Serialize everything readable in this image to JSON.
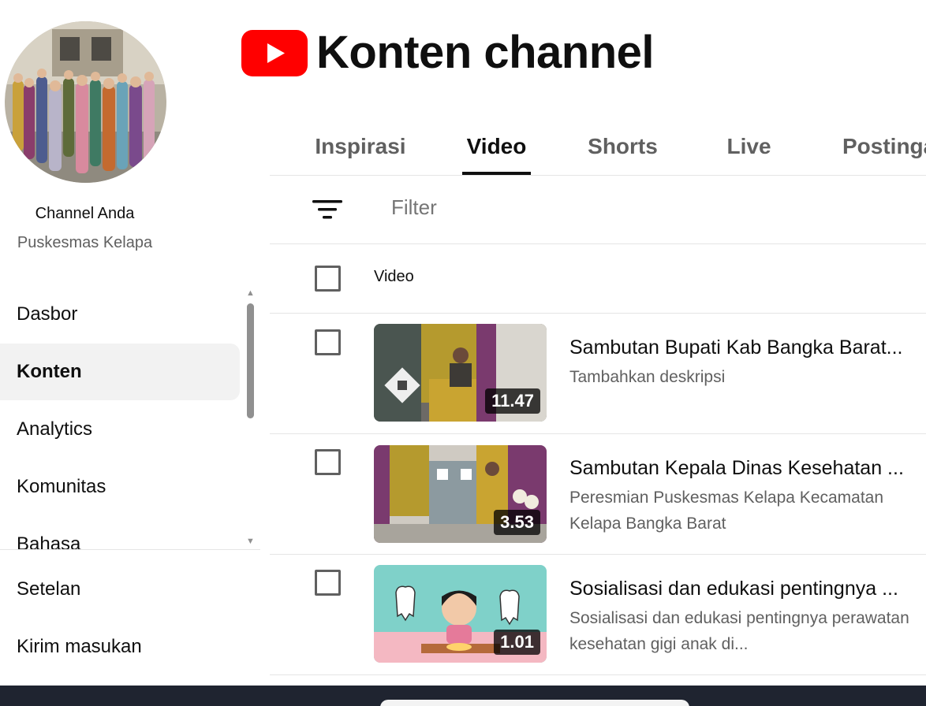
{
  "header": {
    "title": "Konten channel"
  },
  "channel": {
    "label": "Channel Anda",
    "name": "Puskesmas Kelapa"
  },
  "sidebar": {
    "items": [
      {
        "label": "Dasbor"
      },
      {
        "label": "Konten",
        "active": true
      },
      {
        "label": "Analytics"
      },
      {
        "label": "Komunitas"
      },
      {
        "label": "Bahasa"
      }
    ],
    "bottom": [
      {
        "label": "Setelan"
      },
      {
        "label": "Kirim masukan"
      }
    ]
  },
  "tabs": [
    {
      "label": "Inspirasi"
    },
    {
      "label": "Video",
      "active": true
    },
    {
      "label": "Shorts"
    },
    {
      "label": "Live"
    },
    {
      "label": "Postingan"
    }
  ],
  "filter": {
    "placeholder": "Filter"
  },
  "table": {
    "column_video": "Video",
    "rows": [
      {
        "title": "Sambutan Bupati Kab Bangka Barat...",
        "description": "Tambahkan deskripsi",
        "duration": "11.47"
      },
      {
        "title": "Sambutan Kepala Dinas Kesehatan ...",
        "description": "Peresmian Puskesmas Kelapa Kecamatan Kelapa Bangka Barat",
        "duration": "3.53"
      },
      {
        "title": "Sosialisasi dan edukasi pentingnya ...",
        "description": "Sosialisasi dan edukasi pentingnya perawatan kesehatan gigi anak di...",
        "duration": "1.01"
      }
    ]
  },
  "colors": {
    "brand_red": "#ff0000",
    "text_primary": "#0f0f0f",
    "text_secondary": "#606060"
  }
}
